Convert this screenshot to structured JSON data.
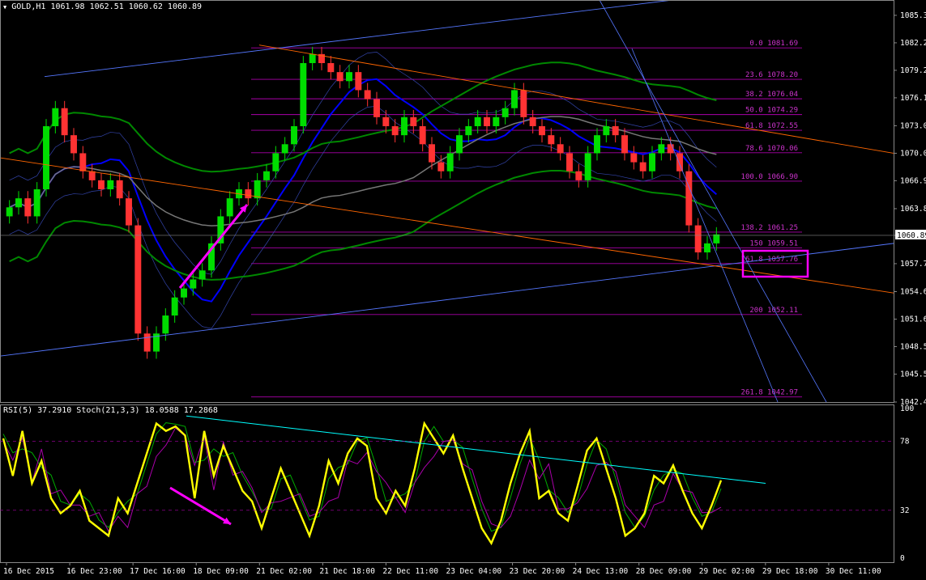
{
  "header": {
    "symbol": "GOLD,H1",
    "ohlc": "1061.98 1062.51 1060.62 1060.89",
    "indicator": "RSI(5) 37.2910  Stoch(21,3,3) 18.0588 17.2868"
  },
  "colors": {
    "background": "#000000",
    "bull_candle": "#00dd00",
    "bear_candle": "#ff3333",
    "bollinger_mid": "#0000ff",
    "envelope_green": "#008800",
    "envelope_grey": "#777777",
    "fib_level": "#aa00aa",
    "trend_blue": "#5577ff",
    "trend_orange": "#ff6600",
    "rsi": "#ffff00",
    "stoch_main": "#00aa00",
    "stoch_signal": "#aa00aa",
    "annotation": "#ff00ff",
    "trend_cyan": "#00ffff"
  },
  "chart_data": [
    {
      "type": "line",
      "name": "price",
      "current_price": "1060.89",
      "ylim": [
        1042.4,
        1087.0
      ],
      "y_ticks": [
        "1085.30",
        "1082.25",
        "1079.20",
        "1076.15",
        "1073.05",
        "1070.00",
        "1066.95",
        "1063.85",
        "1060.89",
        "1057.75",
        "1054.65",
        "1051.60",
        "1048.55",
        "1045.50",
        "1042.40"
      ],
      "x_ticks": [
        "16 Dec 2015",
        "16 Dec 23:00",
        "17 Dec 16:00",
        "18 Dec 09:00",
        "21 Dec 02:00",
        "21 Dec 18:00",
        "22 Dec 11:00",
        "23 Dec 04:00",
        "23 Dec 20:00",
        "24 Dec 13:00",
        "28 Dec 09:00",
        "29 Dec 02:00",
        "29 Dec 18:00",
        "30 Dec 11:00"
      ],
      "close_series": [
        1064,
        1065,
        1063,
        1066,
        1073,
        1075,
        1072,
        1070,
        1068,
        1067,
        1066,
        1067,
        1065,
        1062,
        1050,
        1048,
        1050,
        1052,
        1054,
        1055,
        1056,
        1057,
        1060,
        1063,
        1065,
        1066,
        1065,
        1067,
        1068,
        1070,
        1071,
        1073,
        1080,
        1081,
        1080,
        1079,
        1078,
        1079,
        1077,
        1076,
        1074,
        1073,
        1072,
        1074,
        1073,
        1071,
        1069,
        1068,
        1070,
        1072,
        1073,
        1074,
        1073,
        1074,
        1075,
        1077,
        1074,
        1073,
        1072,
        1071,
        1070,
        1068,
        1067,
        1070,
        1072,
        1073,
        1072,
        1070,
        1069,
        1068,
        1070,
        1071,
        1070,
        1068,
        1062,
        1059,
        1060,
        1061
      ],
      "fib_levels": [
        {
          "ratio": "0.0",
          "price": "1081.69",
          "value": 1081.69
        },
        {
          "ratio": "23.6",
          "price": "1078.20",
          "value": 1078.2
        },
        {
          "ratio": "38.2",
          "price": "1076.04",
          "value": 1076.04
        },
        {
          "ratio": "50.0",
          "price": "1074.29",
          "value": 1074.29
        },
        {
          "ratio": "61.8",
          "price": "1072.55",
          "value": 1072.55
        },
        {
          "ratio": "78.6",
          "price": "1070.06",
          "value": 1070.06
        },
        {
          "ratio": "100.0",
          "price": "1066.90",
          "value": 1066.9
        },
        {
          "ratio": "138.2",
          "price": "1061.25",
          "value": 1061.25
        },
        {
          "ratio": "150",
          "price": "1059.51",
          "value": 1059.51
        },
        {
          "ratio": "161.8",
          "price": "1057.76",
          "value": 1057.76
        },
        {
          "ratio": "200",
          "price": "1052.11",
          "value": 1052.11
        },
        {
          "ratio": "261.8",
          "price": "1042.97",
          "value": 1042.97
        }
      ]
    },
    {
      "type": "line",
      "name": "oscillator",
      "ylim": [
        0,
        100
      ],
      "y_ticks": [
        "100",
        "78",
        "32",
        "0"
      ],
      "rsi_series": [
        80,
        55,
        85,
        50,
        65,
        40,
        30,
        35,
        45,
        25,
        20,
        15,
        40,
        30,
        50,
        70,
        90,
        85,
        88,
        82,
        40,
        85,
        55,
        75,
        60,
        45,
        38,
        20,
        40,
        60,
        45,
        30,
        15,
        35,
        65,
        50,
        70,
        80,
        75,
        40,
        30,
        45,
        35,
        60,
        90,
        80,
        70,
        82,
        60,
        40,
        20,
        10,
        25,
        50,
        70,
        85,
        40,
        45,
        30,
        25,
        48,
        72,
        80,
        60,
        40,
        15,
        20,
        30,
        55,
        50,
        62,
        45,
        30,
        20,
        35,
        52
      ]
    }
  ]
}
